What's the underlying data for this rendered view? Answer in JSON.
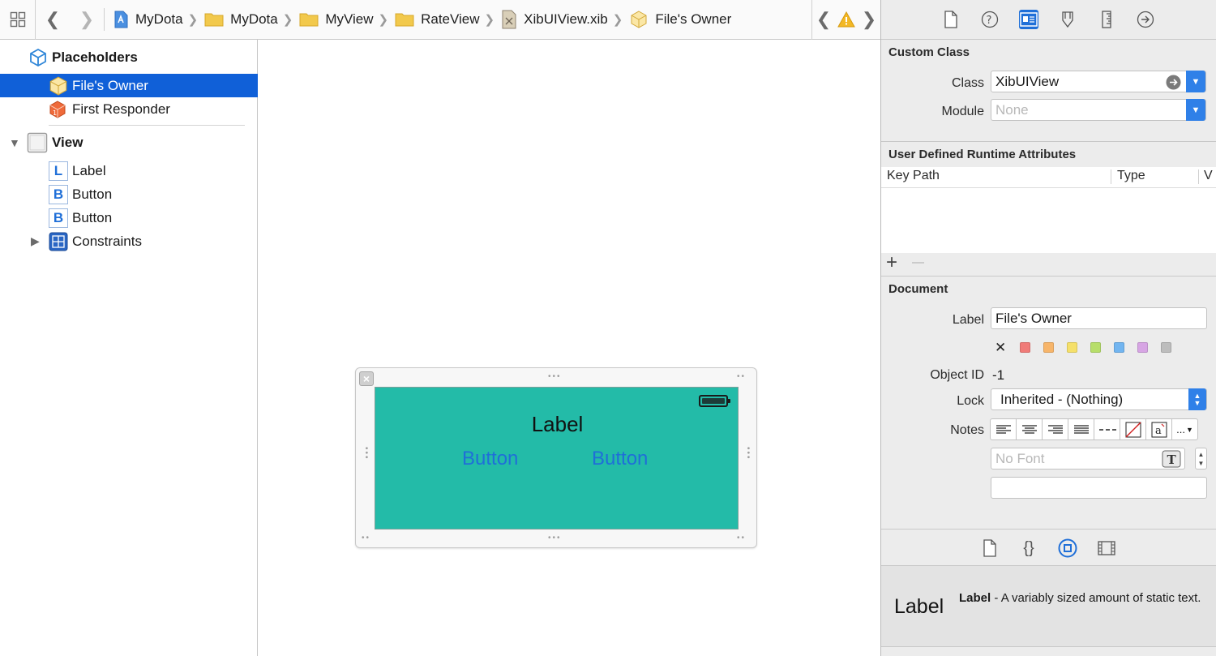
{
  "jumpbar": {
    "crumbs": [
      {
        "label": "MyDota",
        "icon": "project-icon"
      },
      {
        "label": "MyDota",
        "icon": "folder-icon"
      },
      {
        "label": "MyView",
        "icon": "folder-icon"
      },
      {
        "label": "RateView",
        "icon": "folder-icon"
      },
      {
        "label": "XibUIView.xib",
        "icon": "xib-file-icon"
      },
      {
        "label": "File's Owner",
        "icon": "files-owner-cube-icon"
      }
    ]
  },
  "outline": {
    "placeholders_heading": "Placeholders",
    "files_owner": "File's Owner",
    "first_responder": "First Responder",
    "view": "View",
    "label_item": "Label",
    "button_item_1": "Button",
    "button_item_2": "Button",
    "constraints": "Constraints",
    "label_badge": "L",
    "button_badge": "B"
  },
  "canvas": {
    "label_text": "Label",
    "button1_text": "Button",
    "button2_text": "Button",
    "view_bg": "#23bba8"
  },
  "inspector": {
    "custom_class": {
      "title": "Custom Class",
      "class_label": "Class",
      "class_value": "XibUIView",
      "module_label": "Module",
      "module_placeholder": "None"
    },
    "runtime_attrs": {
      "title": "User Defined Runtime Attributes",
      "col_key_path": "Key Path",
      "col_type": "Type",
      "col_value": "V",
      "add": "+",
      "remove": "—"
    },
    "document": {
      "title": "Document",
      "label_label": "Label",
      "label_value": "File's Owner",
      "clear_color": "✕",
      "colors": [
        "#f07b78",
        "#f7b56a",
        "#f5e06a",
        "#b7de6a",
        "#72b5f0",
        "#d7a5e4",
        "#bdbdbd"
      ],
      "object_id_label": "Object ID",
      "object_id_value": "-1",
      "lock_label": "Lock",
      "lock_value": "Inherited - (Nothing)",
      "notes_label": "Notes",
      "font_placeholder": "No Font",
      "notes_more": "..."
    }
  },
  "library": {
    "item_name": "Label",
    "item_title": "Label",
    "item_desc": " - A variably sized amount of static text."
  },
  "colors": {
    "selection": "#1060d8",
    "accent": "#1f6fd8"
  }
}
